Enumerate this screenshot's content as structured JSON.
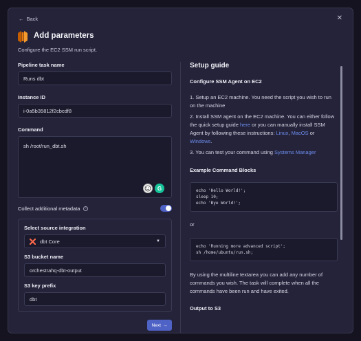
{
  "header": {
    "back_label": "Back",
    "title": "Add parameters",
    "subtitle": "Configure the EC2 SSM run script."
  },
  "form": {
    "task_name": {
      "label": "Pipeline task name",
      "value": "Runs dbt"
    },
    "instance_id": {
      "label": "Instance ID",
      "value": "i-0a5b35812f2cbcdf8"
    },
    "command": {
      "label": "Command",
      "value": "sh /root/run_dbt.sh"
    },
    "metadata": {
      "label": "Collect additional metadata",
      "enabled": true
    },
    "source": {
      "label": "Select source integration",
      "value": "dbt Core"
    },
    "bucket": {
      "label": "S3 bucket name",
      "value": "orchestrahq-dbt-output"
    },
    "prefix": {
      "label": "S3 key prefix",
      "value": "dbt"
    },
    "next_label": "Next"
  },
  "guide": {
    "title": "Setup guide",
    "heading": "Configure SSM Agent on EC2",
    "step1": "1. Setup an EC2 machine. You need the script you wish to run on the machine",
    "step2_a": "2. Install SSM agent on the EC2 machine. You can either follow the quick setup guide ",
    "step2_link_here": "here",
    "step2_b": " or you can manually install SSM Agent by following these instructions: ",
    "step2_link_linux": "Linux",
    "step2_c": ", ",
    "step2_link_macos": "MacOS",
    "step2_d": " or ",
    "step2_link_windows": "Windows",
    "step2_e": ".",
    "step3_a": "3. You can test your command using ",
    "step3_link": "Systems Manager",
    "examples_heading": "Example Command Blocks",
    "code1": "echo 'Hello World!';\nsleep 10;\necho 'Bye World!';",
    "or_text": "or",
    "code2": "echo 'Running more advanced script';\nsh /home/ubuntu/run.sh;",
    "multiline_text": "By using the multiline textarea you can add any number of commands you wish. The task will complete when all the commands have been run and have exited.",
    "output_heading": "Output to S3"
  },
  "colors": {
    "accent": "#4f63c6",
    "link": "#6f8ff0",
    "dbt": "#ff694b",
    "aws": "#e8790a"
  }
}
